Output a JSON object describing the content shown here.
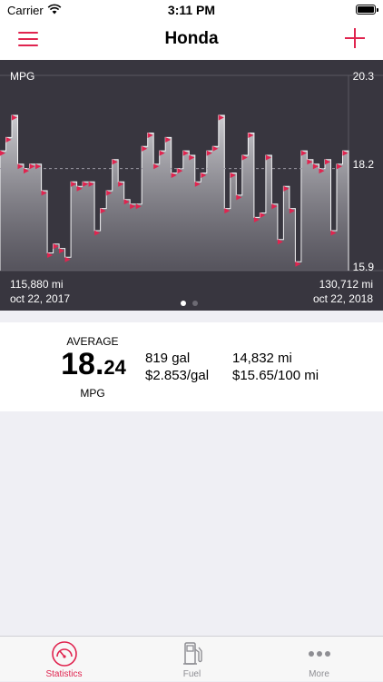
{
  "status_bar": {
    "carrier": "Carrier",
    "time": "3:11 PM"
  },
  "nav": {
    "title": "Honda"
  },
  "chart_data": {
    "type": "area",
    "label": "MPG",
    "ylim": [
      15.9,
      20.3
    ],
    "y_ticks": [
      "20.3",
      "18.2",
      "15.9"
    ],
    "average_line": 18.2,
    "start": {
      "odometer": "115,880 mi",
      "date": "oct 22, 2017"
    },
    "end": {
      "odometer": "130,712 mi",
      "date": "oct 22, 2018"
    },
    "values": [
      18.6,
      18.9,
      19.4,
      18.3,
      18.2,
      18.3,
      18.3,
      17.7,
      16.3,
      16.5,
      16.4,
      16.2,
      17.9,
      17.8,
      17.9,
      17.9,
      16.8,
      17.3,
      17.7,
      18.4,
      17.9,
      17.5,
      17.4,
      17.4,
      18.7,
      19.0,
      18.3,
      18.6,
      18.9,
      18.1,
      18.2,
      18.6,
      18.5,
      17.9,
      18.1,
      18.6,
      18.7,
      19.4,
      17.3,
      18.1,
      17.6,
      18.5,
      19.0,
      17.1,
      17.2,
      18.5,
      17.4,
      16.6,
      17.8,
      17.3,
      16.1,
      18.6,
      18.4,
      18.3,
      18.2,
      18.4,
      16.8,
      18.3,
      18.6
    ]
  },
  "pager": {
    "count": 2,
    "active": 0
  },
  "stats": {
    "average_label": "AVERAGE",
    "average_int": "18.",
    "average_dec": "24",
    "average_unit": "MPG",
    "gallons": "819 gal",
    "price_per_gal": "$2.853/gal",
    "distance": "14,832 mi",
    "cost_per_100": "$15.65/100 mi"
  },
  "tabs": [
    {
      "label": "Statistics",
      "icon": "gauge-icon",
      "active": true
    },
    {
      "label": "Fuel",
      "icon": "fuel-pump-icon",
      "active": false
    },
    {
      "label": "More",
      "icon": "more-dots-icon",
      "active": false
    }
  ],
  "colors": {
    "accent": "#e0244f",
    "chart_bg": "#38363f",
    "inactive": "#8e8e93"
  }
}
